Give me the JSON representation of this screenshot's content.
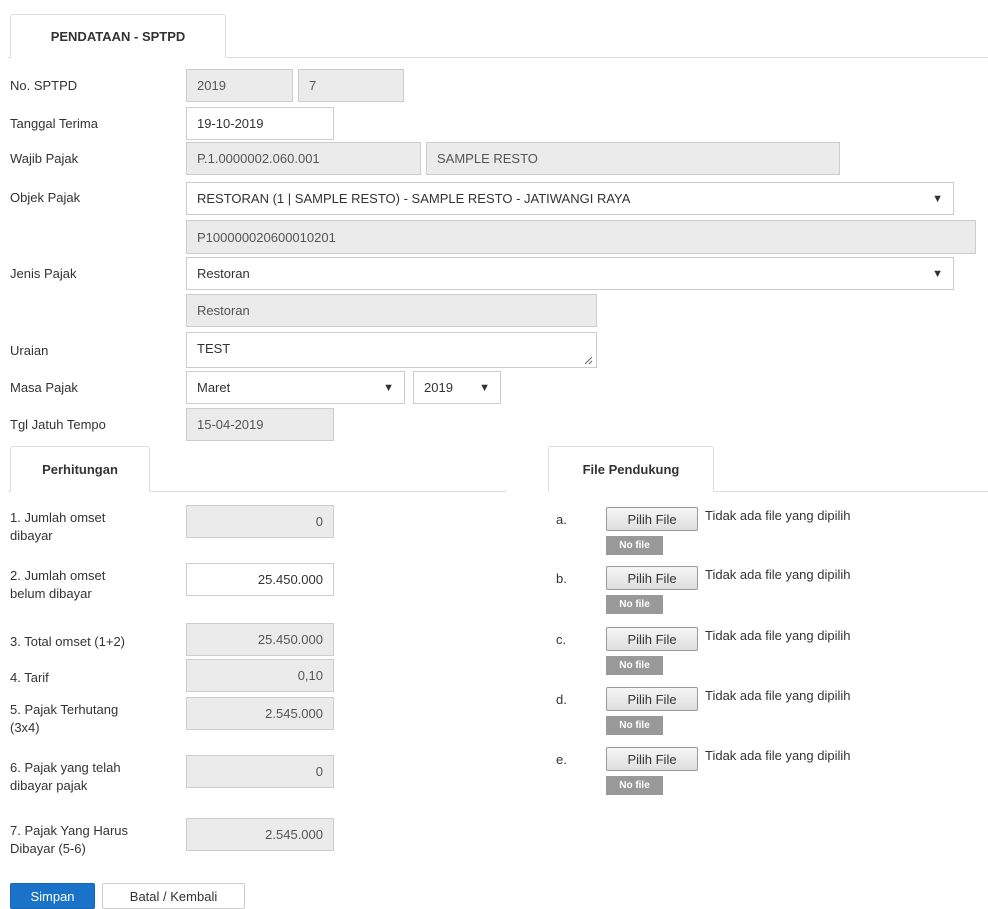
{
  "tabs": {
    "main": "PENDATAAN - SPTPD",
    "perhitungan": "Perhitungan",
    "file_pendukung": "File Pendukung"
  },
  "form": {
    "no_sptpd": {
      "label": "No. SPTPD",
      "year": "2019",
      "number": "7"
    },
    "tanggal_terima": {
      "label": "Tanggal Terima",
      "value": "19-10-2019"
    },
    "wajib_pajak": {
      "label": "Wajib Pajak",
      "npwpd": "P.1.0000002.060.001",
      "name": "SAMPLE RESTO"
    },
    "objek_pajak": {
      "label": "Objek Pajak",
      "selected": "RESTORAN (1 | SAMPLE RESTO) - SAMPLE RESTO - JATIWANGI RAYA",
      "code": "P100000020600010201"
    },
    "jenis_pajak": {
      "label": "Jenis Pajak",
      "selected": "Restoran",
      "readonly": "Restoran"
    },
    "uraian": {
      "label": "Uraian",
      "value": "TEST"
    },
    "masa_pajak": {
      "label": "Masa Pajak",
      "month": "Maret",
      "year": "2019"
    },
    "tgl_jatuh_tempo": {
      "label": "Tgl Jatuh Tempo",
      "value": "15-04-2019"
    }
  },
  "perhitungan": [
    {
      "line1": "1. Jumlah omset",
      "line2": "dibayar",
      "value": "0"
    },
    {
      "line1": "2. Jumlah omset",
      "line2": "belum dibayar",
      "value": "25.450.000"
    },
    {
      "line1": "3. Total omset (1+2)",
      "line2": "",
      "value": "25.450.000"
    },
    {
      "line1": "4. Tarif",
      "line2": "",
      "value": "0,10"
    },
    {
      "line1": "5. Pajak Terhutang",
      "line2": "(3x4)",
      "value": "2.545.000"
    },
    {
      "line1": "6. Pajak yang telah",
      "line2": "dibayar pajak",
      "value": "0"
    },
    {
      "line1": "7. Pajak Yang Harus",
      "line2": "Dibayar (5-6)",
      "value": "2.545.000"
    }
  ],
  "files": [
    {
      "letter": "a.",
      "button": "Pilih File",
      "status": "Tidak ada file yang dipilih",
      "badge": "No file"
    },
    {
      "letter": "b.",
      "button": "Pilih File",
      "status": "Tidak ada file yang dipilih",
      "badge": "No file"
    },
    {
      "letter": "c.",
      "button": "Pilih File",
      "status": "Tidak ada file yang dipilih",
      "badge": "No file"
    },
    {
      "letter": "d.",
      "button": "Pilih File",
      "status": "Tidak ada file yang dipilih",
      "badge": "No file"
    },
    {
      "letter": "e.",
      "button": "Pilih File",
      "status": "Tidak ada file yang dipilih",
      "badge": "No file"
    }
  ],
  "actions": {
    "save": "Simpan",
    "cancel": "Batal / Kembali"
  },
  "icons": {
    "dropdown": "▼"
  },
  "colors": {
    "primary": "#1a73c8",
    "readonly_bg": "#ebebeb",
    "badge": "#999999"
  }
}
